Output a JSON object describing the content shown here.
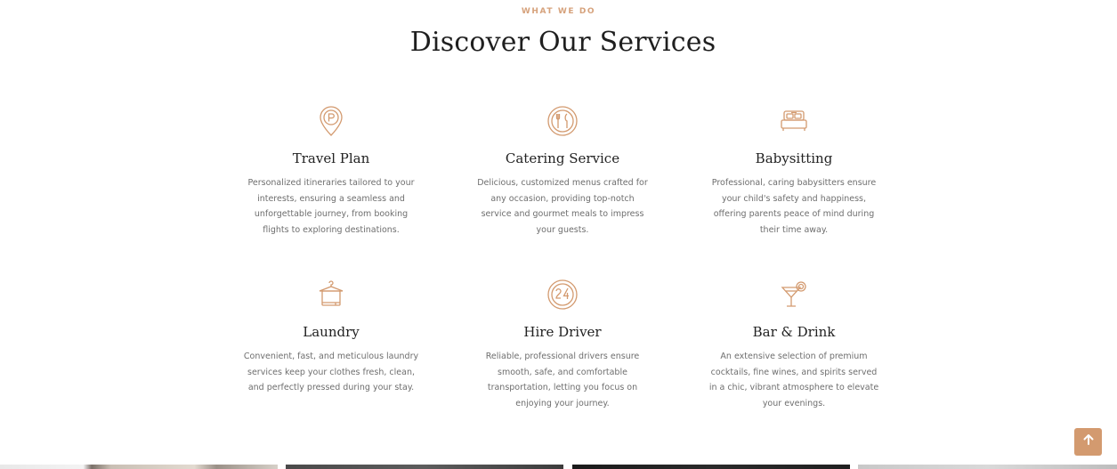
{
  "section": {
    "eyebrow": "WHAT WE DO",
    "title": "Discover Our Services"
  },
  "services": [
    {
      "title": "Travel Plan",
      "description": "Personalized itineraries tailored to your interests, ensuring a seamless and unforgettable journey, from booking flights to exploring destinations.",
      "icon": "map-pin-parking-icon"
    },
    {
      "title": "Catering Service",
      "description": "Delicious, customized menus crafted for any occasion, providing top-notch service and gourmet meals to impress your guests.",
      "icon": "fork-knife-plate-icon"
    },
    {
      "title": "Babysitting",
      "description": "Professional, caring babysitters ensure your child's safety and happiness, offering parents peace of mind during their time away.",
      "icon": "bed-icon"
    },
    {
      "title": "Laundry",
      "description": "Convenient, fast, and meticulous laundry services keep your clothes fresh, clean, and perfectly pressed during your stay.",
      "icon": "laundry-basket-icon"
    },
    {
      "title": "Hire Driver",
      "description": "Reliable, professional drivers ensure smooth, safe, and comfortable transportation, letting you focus on enjoying your journey.",
      "icon": "clock-24-icon"
    },
    {
      "title": "Bar & Drink",
      "description": "An extensive selection of premium cocktails, fine wines, and spirits served in a chic, vibrant atmosphere to elevate your evenings.",
      "icon": "cocktail-glass-icon"
    }
  ],
  "colors": {
    "accent": "#d39a6f",
    "icon_stroke": "#d39a6f",
    "title_text": "#1f1f1f",
    "body_text": "#6e6e6e"
  },
  "back_to_top": {
    "icon": "arrow-up-icon"
  }
}
